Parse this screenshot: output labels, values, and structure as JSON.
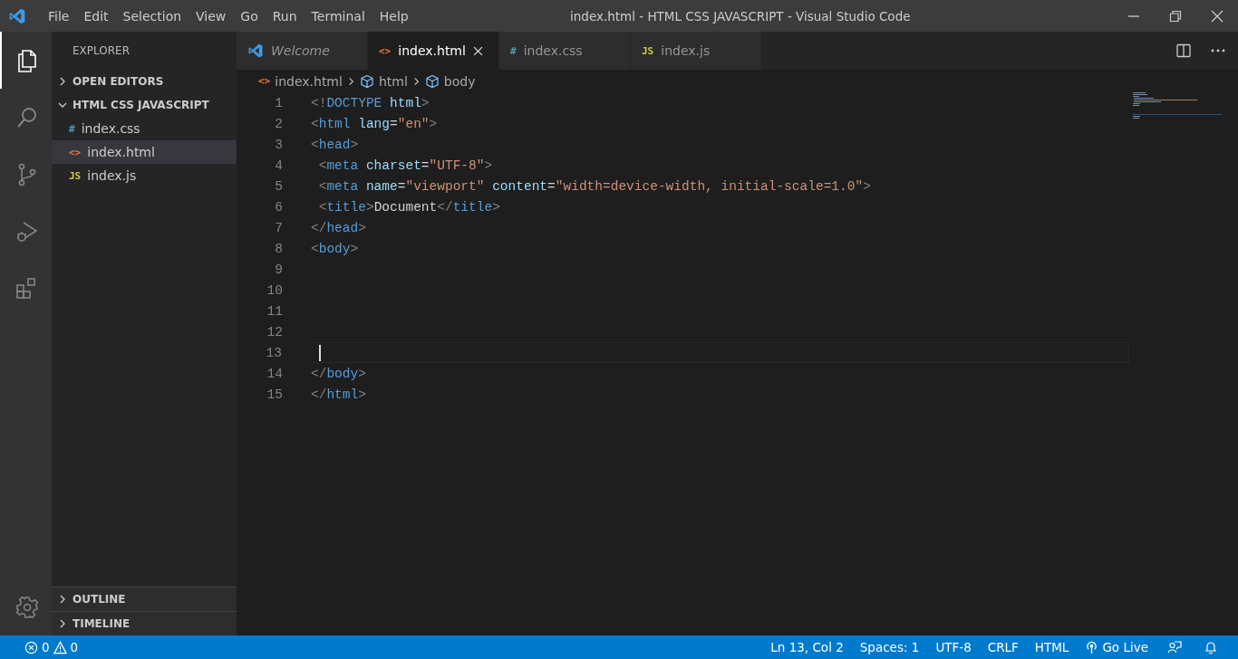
{
  "window": {
    "title": "index.html - HTML CSS JAVASCRIPT - Visual Studio Code"
  },
  "menu": [
    "File",
    "Edit",
    "Selection",
    "View",
    "Go",
    "Run",
    "Terminal",
    "Help"
  ],
  "activity_bar": [
    {
      "kind": "files",
      "selected": true
    },
    {
      "kind": "search",
      "selected": false
    },
    {
      "kind": "source-control",
      "selected": false
    },
    {
      "kind": "run",
      "selected": false
    },
    {
      "kind": "extensions",
      "selected": false
    }
  ],
  "sidebar": {
    "title": "EXPLORER",
    "sections": [
      {
        "label": "OPEN EDITORS",
        "expanded": false
      },
      {
        "label": "HTML CSS JAVASCRIPT",
        "expanded": true,
        "children": [
          {
            "name": "index.css",
            "kind": "css",
            "icon": "#",
            "selected": false
          },
          {
            "name": "index.html",
            "kind": "html",
            "icon": "<>",
            "selected": true
          },
          {
            "name": "index.js",
            "kind": "js",
            "icon": "JS",
            "selected": false
          }
        ]
      }
    ],
    "bottom_sections": [
      {
        "label": "OUTLINE",
        "expanded": false
      },
      {
        "label": "TIMELINE",
        "expanded": false
      }
    ]
  },
  "tabs": [
    {
      "label": "Welcome",
      "kind": "welcome",
      "preview": true,
      "selected": false
    },
    {
      "label": "index.html",
      "kind": "html",
      "icon": "<>",
      "preview": false,
      "selected": true
    },
    {
      "label": "index.css",
      "kind": "css",
      "icon": "#",
      "preview": false,
      "selected": false
    },
    {
      "label": "index.js",
      "kind": "js",
      "icon": "JS",
      "preview": false,
      "selected": false
    }
  ],
  "breadcrumb": [
    {
      "label": "index.html",
      "kind": "file",
      "icon": "<>"
    },
    {
      "label": "html",
      "kind": "symbol"
    },
    {
      "label": "body",
      "kind": "symbol"
    }
  ],
  "editor": {
    "lines": [
      {
        "number": "1",
        "current": false,
        "tokens": [
          {
            "kind": "bracket",
            "text": "<!"
          },
          {
            "kind": "tag",
            "text": "DOCTYPE"
          },
          {
            "kind": "attr",
            "text": " html"
          },
          {
            "kind": "bracket",
            "text": ">"
          }
        ]
      },
      {
        "number": "2",
        "current": false,
        "tokens": [
          {
            "kind": "bracket",
            "text": "<"
          },
          {
            "kind": "tag",
            "text": "html"
          },
          {
            "kind": "attr",
            "text": " lang"
          },
          {
            "kind": "plain",
            "text": "="
          },
          {
            "kind": "string",
            "text": "\"en\""
          },
          {
            "kind": "bracket",
            "text": ">"
          }
        ]
      },
      {
        "number": "3",
        "current": false,
        "tokens": [
          {
            "kind": "bracket",
            "text": "<"
          },
          {
            "kind": "tag",
            "text": "head"
          },
          {
            "kind": "bracket",
            "text": ">"
          }
        ]
      },
      {
        "number": "4",
        "current": false,
        "tokens": [
          {
            "kind": "bracket",
            "text": " <"
          },
          {
            "kind": "tag",
            "text": "meta"
          },
          {
            "kind": "attr",
            "text": " charset"
          },
          {
            "kind": "plain",
            "text": "="
          },
          {
            "kind": "string",
            "text": "\"UTF-8\""
          },
          {
            "kind": "bracket",
            "text": ">"
          }
        ]
      },
      {
        "number": "5",
        "current": false,
        "tokens": [
          {
            "kind": "bracket",
            "text": " <"
          },
          {
            "kind": "tag",
            "text": "meta"
          },
          {
            "kind": "attr",
            "text": " name"
          },
          {
            "kind": "plain",
            "text": "="
          },
          {
            "kind": "string",
            "text": "\"viewport\""
          },
          {
            "kind": "attr",
            "text": " content"
          },
          {
            "kind": "plain",
            "text": "="
          },
          {
            "kind": "string",
            "text": "\"width=device-width, initial-scale=1.0\""
          },
          {
            "kind": "bracket",
            "text": ">"
          }
        ]
      },
      {
        "number": "6",
        "current": false,
        "tokens": [
          {
            "kind": "bracket",
            "text": " <"
          },
          {
            "kind": "tag",
            "text": "title"
          },
          {
            "kind": "bracket",
            "text": ">"
          },
          {
            "kind": "plain",
            "text": "Document"
          },
          {
            "kind": "bracket",
            "text": "</"
          },
          {
            "kind": "tag",
            "text": "title"
          },
          {
            "kind": "bracket",
            "text": ">"
          }
        ]
      },
      {
        "number": "7",
        "current": false,
        "tokens": [
          {
            "kind": "bracket",
            "text": "</"
          },
          {
            "kind": "tag",
            "text": "head"
          },
          {
            "kind": "bracket",
            "text": ">"
          }
        ]
      },
      {
        "number": "8",
        "current": false,
        "tokens": [
          {
            "kind": "bracket",
            "text": "<"
          },
          {
            "kind": "tag",
            "text": "body"
          },
          {
            "kind": "bracket",
            "text": ">"
          }
        ]
      },
      {
        "number": "9",
        "current": false
      },
      {
        "number": "10",
        "current": false
      },
      {
        "number": "11",
        "current": false
      },
      {
        "number": "12",
        "current": false
      },
      {
        "number": "13",
        "current": true
      },
      {
        "number": "14",
        "current": false,
        "tokens": [
          {
            "kind": "bracket",
            "text": "</"
          },
          {
            "kind": "tag",
            "text": "body"
          },
          {
            "kind": "bracket",
            "text": ">"
          }
        ]
      },
      {
        "number": "15",
        "current": false,
        "tokens": [
          {
            "kind": "bracket",
            "text": "</"
          },
          {
            "kind": "tag",
            "text": "html"
          },
          {
            "kind": "bracket",
            "text": ">"
          }
        ]
      }
    ]
  },
  "status_bar": {
    "errors": "0",
    "warnings": "0",
    "right": [
      {
        "label": "Ln 13, Col 2",
        "kind": "text"
      },
      {
        "label": "Spaces: 1",
        "kind": "text"
      },
      {
        "label": "UTF-8",
        "kind": "text"
      },
      {
        "label": "CRLF",
        "kind": "text"
      },
      {
        "label": "HTML",
        "kind": "text"
      },
      {
        "label": "Go Live",
        "kind": "live"
      },
      {
        "kind": "feedback"
      },
      {
        "kind": "bell"
      }
    ]
  }
}
